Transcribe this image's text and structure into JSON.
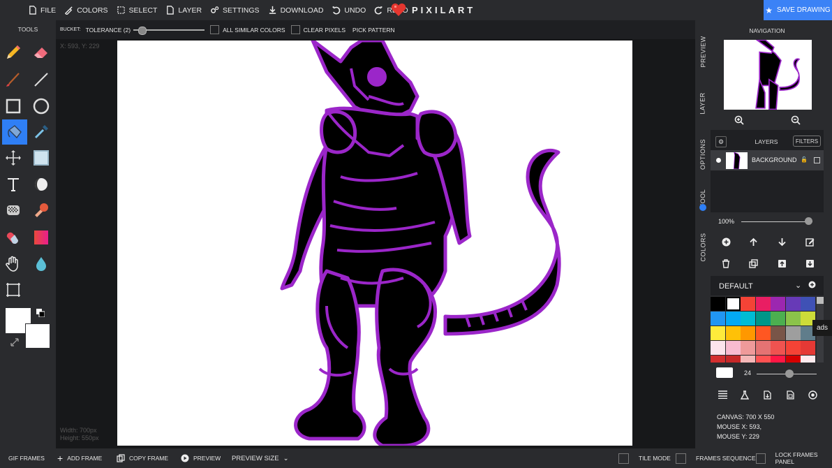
{
  "menu": {
    "file": "FILE",
    "colors": "COLORS",
    "select": "SELECT",
    "layer": "LAYER",
    "settings": "SETTINGS",
    "download": "DOWNLOAD",
    "undo": "UNDO",
    "redo": "REDO",
    "logo": "PIXILART",
    "save": "SAVE DRAWING"
  },
  "options": {
    "tool": "BUCKET:",
    "tolerance": "TOLERANCE (2)",
    "tolerance_value": 0.07,
    "all_similar": "ALL SIMILAR COLORS",
    "clear_pixels": "CLEAR PIXELS",
    "pick_pattern": "PICK PATTERN"
  },
  "tools": {
    "title": "TOOLS",
    "active": "bucket-icon"
  },
  "canvas": {
    "coords": "X: 593, Y: 229",
    "width": "Width: 700px",
    "height": "Height: 550px"
  },
  "tabs": {
    "preview": "PREVIEW",
    "layer": "LAYER",
    "options": "OPTIONS",
    "tool": "TOOL",
    "colors": "COLORS"
  },
  "right": {
    "navigation": "NAVIGATION",
    "layers": "LAYERS",
    "filters": "FILTERS",
    "layer_name": "BACKGROUND",
    "zoom": "100%",
    "palette_name": "DEFAULT",
    "brush_size": "24",
    "ads": "ads",
    "canvas_info": "CANVAS: 700 X 550",
    "mouse_x": "MOUSE X: 593,",
    "mouse_y": "MOUSE Y: 229"
  },
  "palette": [
    "#000000",
    "#ffffff",
    "#f44336",
    "#e91e63",
    "#9c27b0",
    "#673ab7",
    "#3f51b5",
    "#2196f3",
    "#03a9f4",
    "#00bcd4",
    "#009688",
    "#4caf50",
    "#8bc34a",
    "#cddc39",
    "#ffeb3b",
    "#ffc107",
    "#ff9800",
    "#ff5722",
    "#795548",
    "#9e9e9e",
    "#607d8b",
    "#fce4ec",
    "#f8bbd0",
    "#ef9a9a",
    "#e57373",
    "#ef5350",
    "#f44336",
    "#e53935",
    "#d32f2f",
    "#c62828",
    "#f4b7b7",
    "#ff5252",
    "#ff1744",
    "#d50000",
    "#ffebee"
  ],
  "bottom": {
    "gif_frames": "GIF FRAMES",
    "add_frame": "ADD FRAME",
    "copy_frame": "COPY FRAME",
    "preview": "PREVIEW",
    "preview_size": "PREVIEW SIZE",
    "tile_mode": "TILE MODE",
    "frames_sequence": "FRAMES SEQUENCE",
    "lock_frames": "LOCK FRAMES PANEL"
  },
  "colors": {
    "accent": "#2f7ff5",
    "outline": "#9b26c9"
  }
}
